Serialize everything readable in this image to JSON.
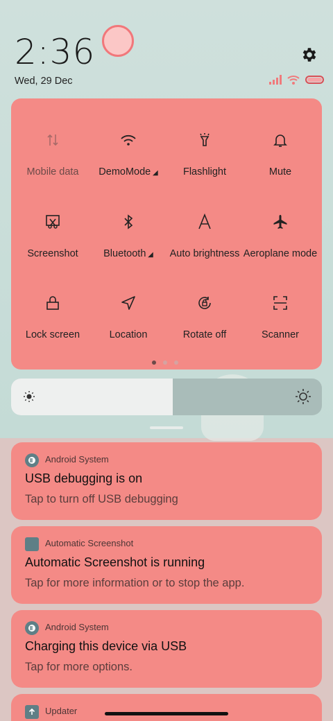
{
  "status": {
    "time": "2:36",
    "date": "Wed, 29 Dec"
  },
  "quick_settings": {
    "tiles": [
      {
        "label": "Mobile data",
        "icon": "mobile-data-icon",
        "active": false
      },
      {
        "label": "DemoMode",
        "icon": "wifi-icon",
        "active": true,
        "has_menu": true
      },
      {
        "label": "Flashlight",
        "icon": "flashlight-icon",
        "active": false
      },
      {
        "label": "Mute",
        "icon": "bell-icon",
        "active": false
      },
      {
        "label": "Screenshot",
        "icon": "screenshot-icon",
        "active": false
      },
      {
        "label": "Bluetooth",
        "icon": "bluetooth-icon",
        "active": false,
        "has_menu": true
      },
      {
        "label": "Auto brightness",
        "icon": "auto-brightness-icon",
        "active": false
      },
      {
        "label": "Aeroplane mode",
        "icon": "airplane-icon",
        "active": false
      },
      {
        "label": "Lock screen",
        "icon": "lock-icon",
        "active": false
      },
      {
        "label": "Location",
        "icon": "location-icon",
        "active": false
      },
      {
        "label": "Rotate off",
        "icon": "rotate-icon",
        "active": false
      },
      {
        "label": "Scanner",
        "icon": "scanner-icon",
        "active": false
      }
    ],
    "page_indicator": {
      "pages": 3,
      "current": 1
    }
  },
  "brightness": {
    "level": 0.52
  },
  "notifications": [
    {
      "app": "Android System",
      "title": "USB debugging is on",
      "body": "Tap to turn off USB debugging"
    },
    {
      "app": "Automatic Screenshot",
      "title": "Automatic Screenshot is running",
      "body": "Tap for more information or to stop the app."
    },
    {
      "app": "Android System",
      "title": "Charging this device via USB",
      "body": "Tap for more options."
    },
    {
      "app": "Updater",
      "title": "",
      "body": ""
    }
  ],
  "colors": {
    "panel": "#f48a86",
    "active_tile": "#fbc7c6",
    "battery": "#f06f74"
  }
}
